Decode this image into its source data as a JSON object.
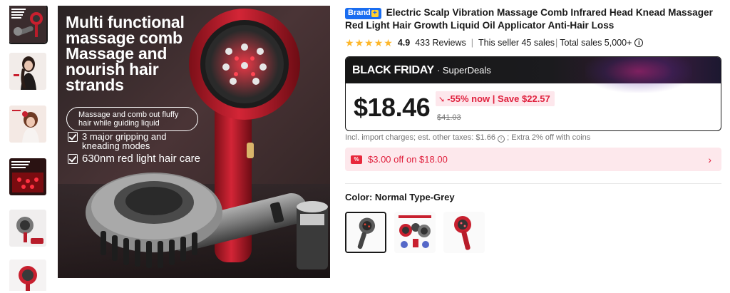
{
  "gallery": {
    "thumbnails": [
      {
        "name": "thumb-1",
        "label": "Multi functional massage comb cover"
      },
      {
        "name": "thumb-2",
        "label": "Model using comb"
      },
      {
        "name": "thumb-3",
        "label": "Model scalp massage"
      },
      {
        "name": "thumb-4",
        "label": "Red light close-up"
      },
      {
        "name": "thumb-5",
        "label": "Comb on stand"
      },
      {
        "name": "thumb-6",
        "label": "Comb detail"
      }
    ],
    "hero": {
      "title_lines": [
        "Multi functional",
        "massage comb",
        "Massage and",
        "nourish hair",
        "strands"
      ],
      "pill": "Massage and comb out fluffy hair while guiding liquid",
      "features": [
        "3 major gripping and kneading modes",
        "630nm red light hair care"
      ]
    }
  },
  "product": {
    "brand_badge": "Brand",
    "brand_plus": "+",
    "title": "Electric Scalp Vibration Massage Comb Infrared Head Knead Massager Red Light Hair Growth Liquid Oil Applicator Anti-Hair Loss",
    "rating": 4.9,
    "rating_text": "4.9",
    "stars": 5,
    "reviews": "433 Reviews",
    "seller_sales": "This seller 45 sales",
    "total_sales": "Total sales 5,000+",
    "info_icon": "i"
  },
  "deal": {
    "event": "BLACK FRIDAY",
    "program": "· SuperDeals",
    "price": "$18.46",
    "discount": "-55% now | Save $22.57",
    "discount_arrow": "➘",
    "original_price": "$41.03"
  },
  "tax_note": "Incl. import charges; est. other taxes: $1.66",
  "tax_icon": "i",
  "tax_extra": "; Extra 2% off with coins",
  "coupon": {
    "icon_text": "%",
    "text": "$3.00 off on $18.00",
    "chevron": "›"
  },
  "color": {
    "label": "Color:",
    "value": "Normal Type-Grey",
    "options": [
      "Normal Type-Grey",
      "Red light set",
      "Normal Type-Red"
    ],
    "selected_index": 0
  },
  "colors": {
    "accent_red": "#e0203d",
    "brand_blue": "#1a6df0",
    "star": "#fdb72c",
    "coupon_bg": "#fde8ec"
  }
}
